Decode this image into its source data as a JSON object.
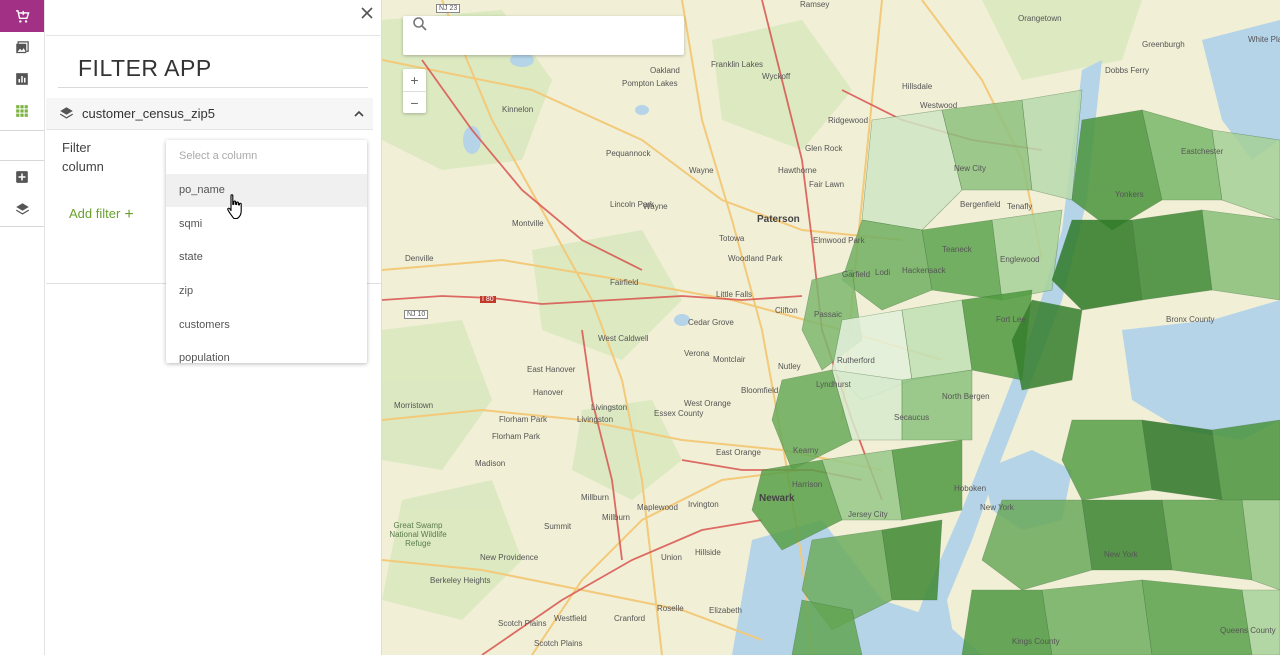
{
  "colors": {
    "accent": "#a23085",
    "add_filter": "#6aa12f",
    "choropleth": "#4f9a45",
    "water": "#b5d4e8"
  },
  "rail": {
    "icons": [
      "cart-icon",
      "image-icon",
      "chart-icon",
      "grid-icon",
      "add-layer-icon",
      "layers-icon"
    ],
    "active": "cart-icon"
  },
  "panel": {
    "title": "FILTER APP",
    "layer_name": "customer_census_zip5",
    "filter_label": "Filter column",
    "add_filter_label": "Add filter",
    "add_filter_symbol": "+"
  },
  "dropdown": {
    "placeholder": "Select a column",
    "options": [
      "po_name",
      "sqmi",
      "state",
      "zip",
      "customers",
      "population"
    ],
    "hovered": "po_name"
  },
  "map": {
    "search_value": "",
    "zoom_in": "+",
    "zoom_out": "−",
    "labels": {
      "oakland": "Oakland",
      "franklin_lakes": "Franklin Lakes",
      "wyckoff": "Wyckoff",
      "hillsdale": "Hillsdale",
      "westwood": "Westwood",
      "pompton_lakes": "Pompton Lakes",
      "kinnelon": "Kinnelon",
      "ramsey": "Ramsey",
      "ridgewood": "Ridgewood",
      "glen_rock": "Glen Rock",
      "pequannock": "Pequannock",
      "wayne": "Wayne",
      "hawthorne": "Hawthorne",
      "fair_lawn": "Fair Lawn",
      "lincoln_park": "Lincoln Park",
      "wayne2": "Wayne",
      "paterson": "Paterson",
      "montville": "Montville",
      "totowa": "Totowa",
      "elmwood_park": "Elmwood Park",
      "denville": "Denville",
      "woodland_park": "Woodland Park",
      "garfield": "Garfield",
      "fairfield": "Fairfield",
      "little_falls": "Little Falls",
      "clifton": "Clifton",
      "cedar_grove": "Cedar Grove",
      "west_caldwell": "West Caldwell",
      "verona": "Verona",
      "montclair": "Montclair",
      "nutley": "Nutley",
      "east_hanover": "East Hanover",
      "hanover": "Hanover",
      "bloomfield": "Bloomfield",
      "morristown": "Morristown",
      "livingston": "Livingston",
      "west_orange": "West Orange",
      "essex_county": "Essex County",
      "florham_park": "Florham Park",
      "livingston2": "Livingston",
      "florham_park2": "Florham Park",
      "madison": "Madison",
      "east_orange": "East Orange",
      "millburn": "Millburn",
      "maplewood": "Maplewood",
      "irvington": "Irvington",
      "millburn2": "Millburn",
      "summit": "Summit",
      "great_swamp": "Great Swamp National Wildlife Refuge",
      "new_providence": "New Providence",
      "union": "Union",
      "hillside": "Hillside",
      "berkeley_heights": "Berkeley Heights",
      "scotch_plains": "Scotch Plains",
      "westfield": "Westfield",
      "cranford": "Cranford",
      "roselle": "Roselle",
      "elizabeth": "Elizabeth",
      "scotch_plains2": "Scotch Plains",
      "dobbs_ferry": "Dobbs Ferry",
      "eastchester": "Eastchester",
      "orangetown": "Orangetown",
      "greenburgh": "Greenburgh",
      "white_plains": "White Plains",
      "yonkers": "Yonkers",
      "teaneck": "Teaneck",
      "englewood": "Englewood",
      "hackensack": "Hackensack",
      "lodi": "Lodi",
      "passaic": "Passaic",
      "rutherford": "Rutherford",
      "lyndhurst": "Lyndhurst",
      "north_bergen": "North Bergen",
      "secaucus": "Secaucus",
      "kearny": "Kearny",
      "harrison": "Harrison",
      "newark": "Newark",
      "hoboken": "Hoboken",
      "jersey_city": "Jersey City",
      "new_york": "New York",
      "new_york2": "New York",
      "queens_county": "Queens County",
      "kings_county": "Kings County",
      "bronx_county": "Bronx County",
      "fort_lee": "Fort Lee",
      "tenafly": "Tenafly",
      "bergenfield": "Bergenfield",
      "new_city": "New City",
      "nj23": "NJ 23",
      "nj10": "NJ 10",
      "i80": "I 80"
    }
  }
}
